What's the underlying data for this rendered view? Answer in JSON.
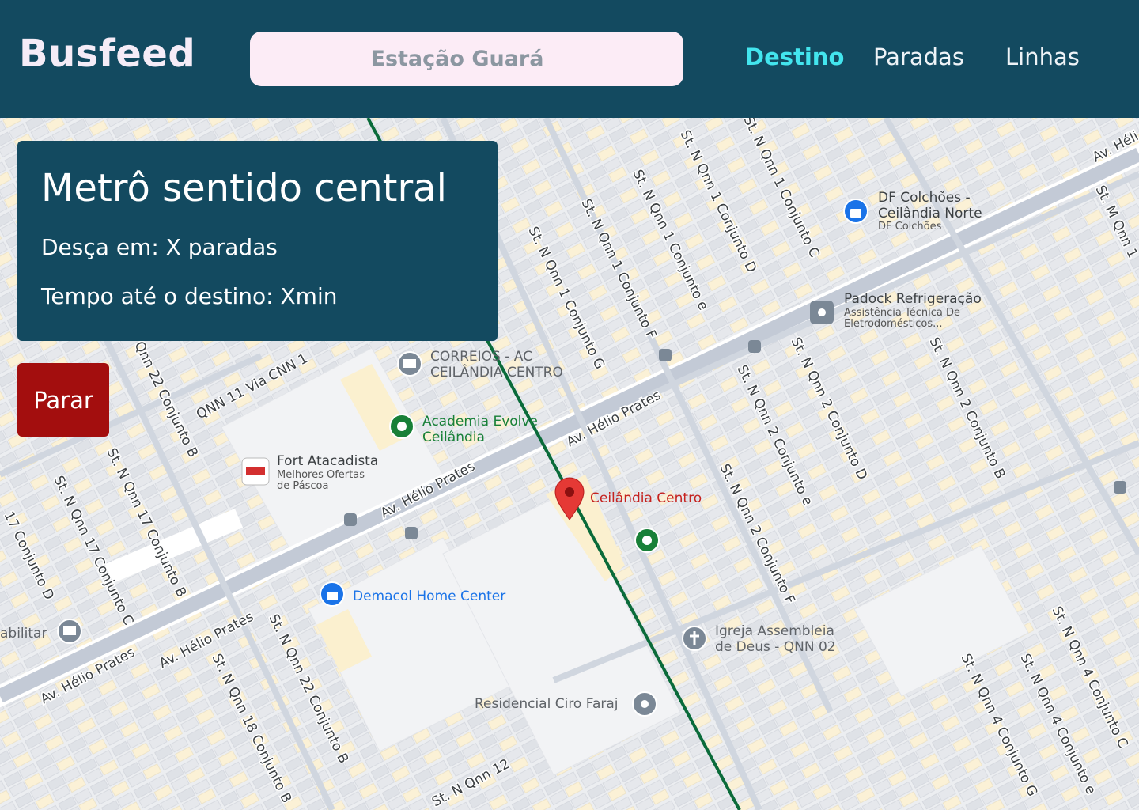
{
  "app": {
    "name": "Busfeed"
  },
  "search": {
    "value": "Estação Guará"
  },
  "nav": {
    "items": [
      "Destino",
      "Paradas",
      "Linhas"
    ],
    "active": "Destino"
  },
  "colors": {
    "header": "#134a60",
    "accent": "#43e5ee",
    "stop": "#a30e0e",
    "route": "#0a6b3a",
    "marker": "#e53935"
  },
  "info_card": {
    "title": "Metrô sentido central",
    "stops_line": "Desça em:  X paradas",
    "time_line": "Tempo até o destino: Xmin"
  },
  "stop_button": {
    "label": "Parar"
  },
  "map": {
    "destination": "Ceilândia Centro",
    "pois": [
      {
        "name": "DF Colchões - Ceilândia Norte",
        "sub": "DF Colchões",
        "icon": "shopping-bag-icon"
      },
      {
        "name": "Padock Refrigeração",
        "sub": "Assistência Técnica De Eletrodomésticos...",
        "icon": "store-icon"
      },
      {
        "name": "CORREIOS - AC CEILÂNDIA CENTRO",
        "icon": "mail-icon"
      },
      {
        "name": "Academia Evolve Ceilândia",
        "icon": "gym-icon"
      },
      {
        "name": "Fort Atacadista",
        "sub": "Melhores Ofertas de Páscoa",
        "icon": "store-logo-icon"
      },
      {
        "name": "Demacol Home Center",
        "icon": "shopping-bag-icon"
      },
      {
        "name": "Igreja Assembleia de Deus - QNN 02",
        "icon": "church-icon"
      },
      {
        "name": "Residencial Ciro Faraj",
        "icon": "place-icon"
      },
      {
        "name": "abilitar",
        "icon": "bank-icon"
      }
    ],
    "roads": [
      "Av. Hélio Prates",
      "QNN 11 Via CNN 1",
      "St. N Qnn 1 Conjunto G",
      "St. N Qnn 1 Conjunto F",
      "St. N Qnn 1 Conjunto e",
      "St. N Qnn 1 Conjunto D",
      "St. N Qnn 1 Conjunto C",
      "St. N Qnn 2 Conjunto D",
      "St. N Qnn 2 Conjunto B",
      "St. N Qnn 2 Conjunto e",
      "St. N Qnn 2 Conjunto F",
      "Qnn 22 Conjunto B",
      "St. N Qnn 17 Conjunto B",
      "St. N Qnn 17 Conjunto C",
      "17 Conjunto D",
      "St. N Qnn 22 Conjunto B",
      "St. N Qnn 18 Conjunto B",
      "St. N Qnn 4 Conjunto C",
      "St. N Qnn 4 Conjunto e",
      "St. N Qnn 4 Conjunto G",
      "St. N Qnn 12",
      "St. M Qnn 1",
      "Av. Héli"
    ]
  }
}
